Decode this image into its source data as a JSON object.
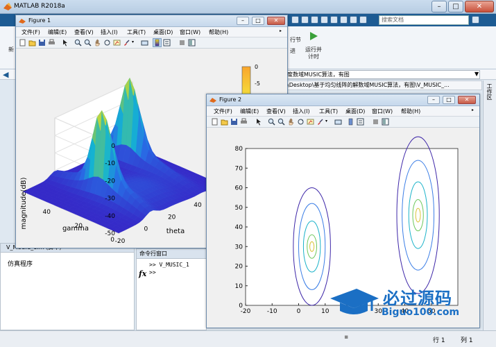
{
  "app": {
    "title": "MATLAB R2018a",
    "search_placeholder": "搜索文档",
    "ribbon_labels": [
      "新",
      "行节",
      "进",
      "运行并",
      "计时"
    ],
    "address_path": "度数域MUSIC算法，有图",
    "address_path_full": "\\Desktop\\基于均匀线阵的解数域MUSIC算法，有图\\V_MUSIC_...",
    "workspace_label": "工作区",
    "left_pane_header": "V_MUSIC_1.m (脚本)",
    "left_pane_text": "仿真程序",
    "cmd_header": "命令行窗口",
    "cmd_lines": [
      ">> V_MUSIC_1",
      ">>"
    ],
    "fx": "fx",
    "status_row": "行 1",
    "status_col": "列 1"
  },
  "figure1": {
    "title": "Figure 1",
    "menu": [
      "文件(F)",
      "编辑(E)",
      "查看(V)",
      "插入(I)",
      "工具(T)",
      "桌面(D)",
      "窗口(W)",
      "帮助(H)"
    ],
    "colorbar_ticks": [
      "0",
      "-5"
    ]
  },
  "figure2": {
    "title": "Figure 2",
    "menu": [
      "文件(F)",
      "编辑(E)",
      "查看(V)",
      "插入(I)",
      "工具(T)",
      "桌面(D)",
      "窗口(W)",
      "帮助(H)"
    ]
  },
  "watermark": {
    "text": "必过源码",
    "url": "Biguo100.com"
  },
  "chart_data": [
    {
      "type": "surface",
      "zlabel": "magnitude(dB)",
      "xlabel": "theta",
      "ylabel": "gamma",
      "zticks": [
        0,
        -10,
        -20,
        -30,
        -40,
        -50
      ],
      "gamma_ticks": [
        0,
        20,
        40
      ],
      "theta_ticks": [
        -20,
        0,
        20,
        40
      ],
      "zlim": [
        -50,
        0
      ],
      "peaks": [
        {
          "theta": 5,
          "gamma": 30,
          "magnitude_db": -2
        },
        {
          "theta": 45,
          "gamma": 45,
          "magnitude_db": -2
        }
      ],
      "floor_db": -50,
      "colormap": "parula"
    },
    {
      "type": "contour",
      "xlim": [
        -20,
        60
      ],
      "ylim": [
        0,
        80
      ],
      "xticks": [
        -20,
        -10,
        0,
        10,
        20,
        30,
        40,
        50
      ],
      "yticks": [
        0,
        10,
        20,
        30,
        40,
        50,
        60,
        70,
        80
      ],
      "centers": [
        {
          "theta": 5,
          "gamma": 30,
          "rx": [
            7,
            5,
            3.2,
            1.8,
            0.8
          ],
          "ry": [
            30,
            22,
            13,
            6,
            2.5
          ]
        },
        {
          "theta": 45,
          "gamma": 46,
          "rx": [
            8,
            6,
            3.5,
            2,
            0.9
          ],
          "ry": [
            40,
            28,
            17,
            8,
            3.5
          ]
        }
      ],
      "grid": false
    }
  ]
}
